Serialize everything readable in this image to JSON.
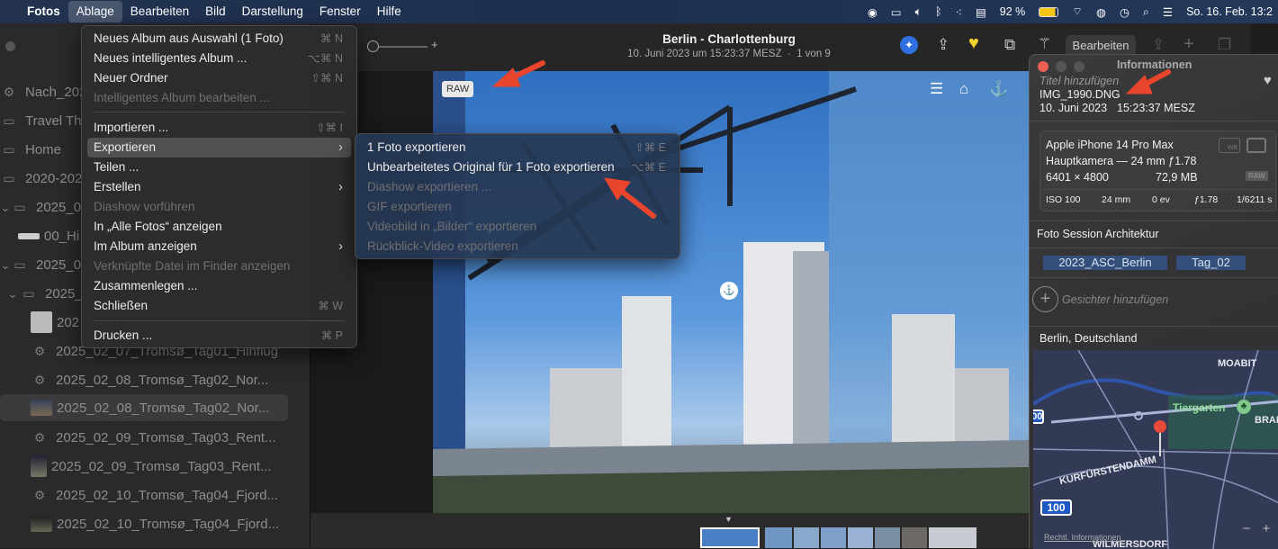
{
  "menubar": {
    "apple": "",
    "items": [
      "Fotos",
      "Ablage",
      "Bearbeiten",
      "Bild",
      "Darstellung",
      "Fenster",
      "Hilfe"
    ],
    "battery": "92 %",
    "datetime": "So. 16. Feb. 13:2"
  },
  "sidebar": {
    "items": [
      "Nach_202",
      "Travel The",
      "Home",
      "2020-202",
      "2025_0",
      "00_Hi",
      "2025_0",
      "2025_",
      "202",
      "2025_02_07_Tromsø_Tag01_Hinflug",
      "2025_02_08_Tromsø_Tag02_Nor...",
      "2025_02_08_Tromsø_Tag02_Nor...",
      "2025_02_09_Tromsø_Tag03_Rent...",
      "2025_02_09_Tromsø_Tag03_Rent...",
      "2025_02_10_Tromsø_Tag04_Fjord...",
      "2025_02_10_Tromsø_Tag04_Fjord..."
    ]
  },
  "toolbar": {
    "title": "Berlin - Charlottenburg",
    "subtitle": "10. Juni 2023 um 15:23:37 MESZ  ·  1 von 9",
    "edit": "Bearbeiten",
    "zoom_plus": "+"
  },
  "photo": {
    "badge": "RAW"
  },
  "menu": {
    "items": [
      {
        "label": "Neues Album aus Auswahl (1 Foto)",
        "shortcut": "⌘ N"
      },
      {
        "label": "Neues intelligentes Album ...",
        "shortcut": "⌥⌘ N"
      },
      {
        "label": "Neuer Ordner",
        "shortcut": "⇧⌘ N"
      },
      {
        "label": "Intelligentes Album bearbeiten ...",
        "shortcut": ""
      },
      {
        "label": "Importieren ...",
        "shortcut": "⇧⌘ I"
      },
      {
        "label": "Exportieren",
        "shortcut": "›"
      },
      {
        "label": "Teilen ...",
        "shortcut": ""
      },
      {
        "label": "Erstellen",
        "shortcut": "›"
      },
      {
        "label": "Diashow vorführen",
        "shortcut": ""
      },
      {
        "label": "In „Alle Fotos“ anzeigen",
        "shortcut": ""
      },
      {
        "label": "Im Album anzeigen",
        "shortcut": "›"
      },
      {
        "label": "Verknüpfte Datei im Finder anzeigen",
        "shortcut": ""
      },
      {
        "label": "Zusammenlegen ...",
        "shortcut": ""
      },
      {
        "label": "Schließen",
        "shortcut": "⌘ W"
      },
      {
        "label": "Drucken ...",
        "shortcut": "⌘ P"
      }
    ]
  },
  "submenu": {
    "items": [
      {
        "label": "1 Foto exportieren",
        "shortcut": "⇧⌘ E"
      },
      {
        "label": "Unbearbeitetes Original für 1 Foto exportieren",
        "shortcut": "⌥⌘ E"
      },
      {
        "label": "Diashow exportieren ...",
        "shortcut": ""
      },
      {
        "label": "GIF exportieren",
        "shortcut": ""
      },
      {
        "label": "Videobild in „Bilder“ exportieren",
        "shortcut": ""
      },
      {
        "label": "Rückblick-Video exportieren",
        "shortcut": ""
      }
    ]
  },
  "info": {
    "window_title": "Informationen",
    "title_placeholder": "Titel hinzufügen",
    "filename": "IMG_1990.DNG",
    "date": "10. Juni 2023",
    "time": "15:23:37 MESZ",
    "camera": "Apple iPhone 14 Pro Max",
    "lens": "Hauptkamera — 24 mm ƒ1.78",
    "resolution": "6401 × 4800",
    "filesize": "72,9 MB",
    "raw_badge": "RAW",
    "wb_label": "WB",
    "exif": [
      "ISO 100",
      "24 mm",
      "0 ev",
      "ƒ1.78",
      "1/6211 s"
    ],
    "caption": "Foto Session Architektur",
    "keywords": [
      "2023_ASC_Berlin",
      "Tag_02"
    ],
    "faces_placeholder": "Gesichter hinzufügen",
    "location": "Berlin, Deutschland",
    "map": {
      "labels": [
        "MOABIT",
        "Tiergarten",
        "BRAN",
        "KURFÜRSTENDAMM",
        "WILMERSDORF"
      ],
      "road_shields": [
        "100",
        "100"
      ],
      "legal": "Rechtl. Informationen",
      "zoom_out": "−",
      "zoom_in": "+"
    }
  },
  "colors": {
    "accent": "#0a84ff",
    "arrow": "#e8452c",
    "favorite": "#f7d22f"
  }
}
